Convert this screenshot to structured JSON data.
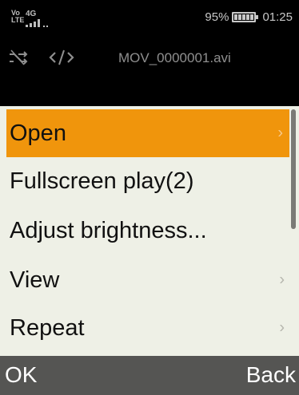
{
  "status_bar": {
    "volte": "Vo LTE",
    "network": "4G",
    "signal_bars": 4,
    "battery_percent": "95%",
    "battery_level": 0.95,
    "time": "01:25"
  },
  "player": {
    "filename": "MOV_0000001.avi",
    "shuffle_icon": "shuffle-off-icon",
    "code_icon": "code-off-icon"
  },
  "menu": {
    "items": [
      {
        "label": "Open",
        "has_submenu": true,
        "selected": true
      },
      {
        "label": "Fullscreen play(2)",
        "has_submenu": false,
        "selected": false
      },
      {
        "label": "Adjust brightness...",
        "has_submenu": false,
        "selected": false
      },
      {
        "label": "View",
        "has_submenu": true,
        "selected": false
      },
      {
        "label": "Repeat",
        "has_submenu": true,
        "selected": false
      }
    ],
    "chevron": "›"
  },
  "softkeys": {
    "left": "OK",
    "right": "Back"
  },
  "colors": {
    "highlight": "#f0950c",
    "menu_bg": "#eef0e6",
    "softkey_bg": "#555553"
  }
}
